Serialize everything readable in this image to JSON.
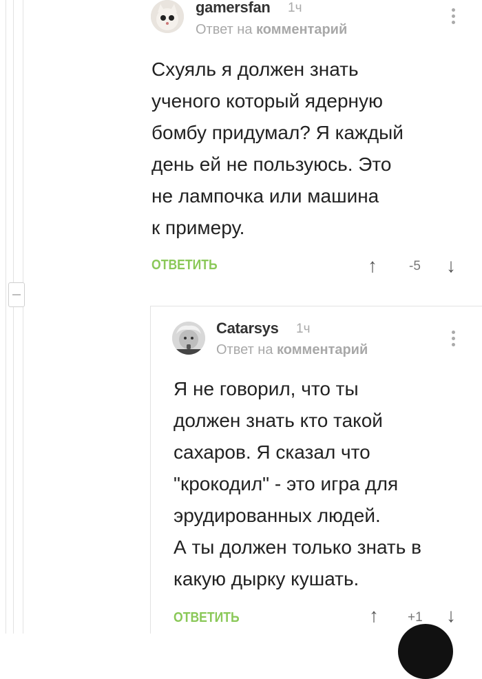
{
  "comments": [
    {
      "author": "gamersfan",
      "time": "1ч",
      "reply_prefix": "Ответ на",
      "reply_target": "комментарий",
      "body": "Схуяль я должен знать\nученого который ядерную\nбомбу придумал? Я каждый\nдень ей не пользуюсь. Это\nне лампочка или машина\nк примеру.",
      "reply_label": "ОТВЕТИТЬ",
      "score": "-5"
    },
    {
      "author": "Catarsys",
      "time": "1ч",
      "reply_prefix": "Ответ на",
      "reply_target": "комментарий",
      "body": "Я не говорил, что ты\nдолжен знать кто такой\nсахаров. Я сказал что\n\"крокодил\" - это игра для\nэрудированных людей.\nА ты должен только знать в\nкакую дырку кушать.",
      "reply_label": "ОТВЕТИТЬ",
      "score": "+1"
    }
  ],
  "icons": {
    "upvote": "arrow-up-icon",
    "downvote": "arrow-down-icon",
    "more": "more-vertical-icon",
    "collapse": "minus-icon"
  },
  "colors": {
    "reply_link": "#8ac858",
    "thread_line": "#e2e2e2",
    "muted_text": "#a8a8a8"
  }
}
